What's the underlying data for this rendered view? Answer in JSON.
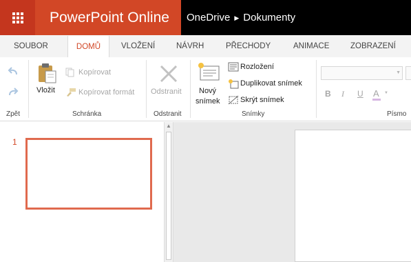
{
  "app": {
    "name": "PowerPoint Online",
    "breadcrumb": [
      "OneDrive",
      "Dokumenty"
    ],
    "brand_color": "#d24726",
    "waffle_color": "#c4361e",
    "waffle_icon": "app-launcher-icon",
    "breadcrumb_separator_icon": "triangle-right-icon"
  },
  "tabs": [
    {
      "label": "SOUBOR",
      "active": false
    },
    {
      "label": "DOMŮ",
      "active": true
    },
    {
      "label": "VLOŽENÍ",
      "active": false
    },
    {
      "label": "NÁVRH",
      "active": false
    },
    {
      "label": "PŘECHODY",
      "active": false
    },
    {
      "label": "ANIMACE",
      "active": false
    },
    {
      "label": "ZOBRAZENÍ",
      "active": false
    }
  ],
  "ribbon": {
    "zpet": {
      "label": "Zpět",
      "undo_icon": "undo-icon",
      "redo_icon": "redo-icon"
    },
    "schranka": {
      "label": "Schránka",
      "paste": "Vložit",
      "copy": "Kopírovat",
      "format_painter": "Kopírovat formát",
      "paste_icon": "clipboard-icon",
      "copy_icon": "copy-icon",
      "format_painter_icon": "brush-icon"
    },
    "odstranit": {
      "label": "Odstranit",
      "button": "Odstranit",
      "icon": "delete-x-icon"
    },
    "snimky": {
      "label": "Snímky",
      "new_slide_line1": "Nový",
      "new_slide_line2": "snímek",
      "layout": "Rozložení",
      "duplicate": "Duplikovat snímek",
      "hide": "Skrýt snímek",
      "new_slide_icon": "new-slide-icon",
      "layout_icon": "layout-icon",
      "duplicate_icon": "duplicate-slide-icon",
      "hide_icon": "hide-slide-icon"
    },
    "pismo": {
      "label": "Písmo",
      "bold": "B",
      "italic": "I",
      "underline": "U",
      "font_color": "A",
      "font_family_value": "",
      "font_size_value": ""
    }
  },
  "slides": [
    {
      "number": "1",
      "selected": true
    }
  ],
  "selection_color": "#e06a4e"
}
